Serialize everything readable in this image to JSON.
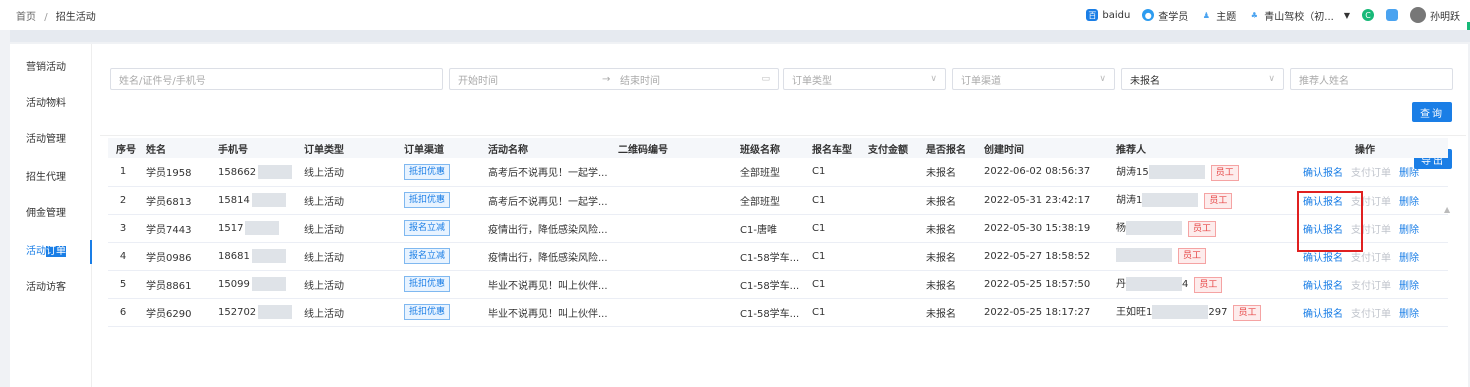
{
  "breadcrumb": {
    "home": "首页",
    "sep": "/",
    "current": "招生活动"
  },
  "topbar": {
    "items": [
      {
        "icon": "baidu-icon",
        "label": "baidu"
      },
      {
        "icon": "student-icon",
        "label": "查学员"
      },
      {
        "icon": "theme-icon",
        "label": "主题"
      },
      {
        "icon": "school-icon",
        "label": "青山驾校（初..."
      }
    ],
    "user_name": "孙明跃"
  },
  "sidebar": {
    "items": [
      {
        "label": "营销活动"
      },
      {
        "label": "活动物料"
      },
      {
        "label": "活动管理"
      },
      {
        "label": "招生代理"
      },
      {
        "label": "佣金管理"
      },
      {
        "label_a": "活动",
        "label_b": "订单",
        "active": true
      },
      {
        "label": "活动访客"
      }
    ]
  },
  "filters": {
    "search_placeholder": "姓名/证件号/手机号",
    "start_placeholder": "开始时间",
    "arrow": "→",
    "end_placeholder": "结束时间",
    "order_type_placeholder": "订单类型",
    "order_channel_placeholder": "订单渠道",
    "signup_status_value": "未报名",
    "referrer_placeholder": "推荐人姓名",
    "query_button": "查询",
    "export_button": "导出"
  },
  "table": {
    "columns": [
      "序号",
      "姓名",
      "手机号",
      "订单类型",
      "订单渠道",
      "活动名称",
      "二维码编号",
      "班级名称",
      "报名车型",
      "支付金额",
      "是否报名",
      "创建时间",
      "推荐人",
      "操作"
    ],
    "rows": [
      {
        "index": "1",
        "name": "学员1958",
        "phone": "158662",
        "order_type": "线上活动",
        "channel": "抵扣优惠",
        "activity": "高考后不说再见！一起学...",
        "qr": "",
        "class": "全部班型",
        "car": "C1",
        "amount": "",
        "signed": "未报名",
        "created": "2022-06-02 08:56:37",
        "referrer_prefix": "胡涛15",
        "referrer_suffix": "",
        "referrer_tag": "员工"
      },
      {
        "index": "2",
        "name": "学员6813",
        "phone": "15814",
        "order_type": "线上活动",
        "channel": "抵扣优惠",
        "activity": "高考后不说再见！一起学...",
        "qr": "",
        "class": "全部班型",
        "car": "C1",
        "amount": "",
        "signed": "未报名",
        "created": "2022-05-31 23:42:17",
        "referrer_prefix": "胡涛1",
        "referrer_suffix": "",
        "referrer_tag": "员工"
      },
      {
        "index": "3",
        "name": "学员7443",
        "phone": "1517",
        "order_type": "线上活动",
        "channel": "报名立减",
        "activity": "疫情出行，降低感染风险...",
        "qr": "",
        "class": "C1-唐唯",
        "car": "C1",
        "amount": "",
        "signed": "未报名",
        "created": "2022-05-30 15:38:19",
        "referrer_prefix": "杨",
        "referrer_suffix": "",
        "referrer_tag": "员工"
      },
      {
        "index": "4",
        "name": "学员0986",
        "phone": "18681",
        "order_type": "线上活动",
        "channel": "报名立减",
        "activity": "疫情出行，降低感染风险...",
        "qr": "",
        "class": "C1-58学车...",
        "car": "C1",
        "amount": "",
        "signed": "未报名",
        "created": "2022-05-27 18:58:52",
        "referrer_prefix": "",
        "referrer_suffix": "",
        "referrer_tag": "员工"
      },
      {
        "index": "5",
        "name": "学员8861",
        "phone": "15099",
        "order_type": "线上活动",
        "channel": "抵扣优惠",
        "activity": "毕业不说再见！叫上伙伴...",
        "qr": "",
        "class": "C1-58学车...",
        "car": "C1",
        "amount": "",
        "signed": "未报名",
        "created": "2022-05-25 18:57:50",
        "referrer_prefix": "丹",
        "referrer_suffix": "4",
        "referrer_tag": "员工"
      },
      {
        "index": "6",
        "name": "学员6290",
        "phone": "152702",
        "order_type": "线上活动",
        "channel": "抵扣优惠",
        "activity": "毕业不说再见！叫上伙伴...",
        "qr": "",
        "class": "C1-58学车...",
        "car": "C1",
        "amount": "",
        "signed": "未报名",
        "created": "2022-05-25 18:17:27",
        "referrer_prefix": "王如旺1",
        "referrer_suffix": "297",
        "referrer_tag": "员工"
      }
    ],
    "actions": {
      "confirm": "确认报名",
      "pay": "支付订单",
      "delete": "删除"
    }
  },
  "colors": {
    "accent": "#1a7ee6",
    "danger": "#e02020"
  }
}
